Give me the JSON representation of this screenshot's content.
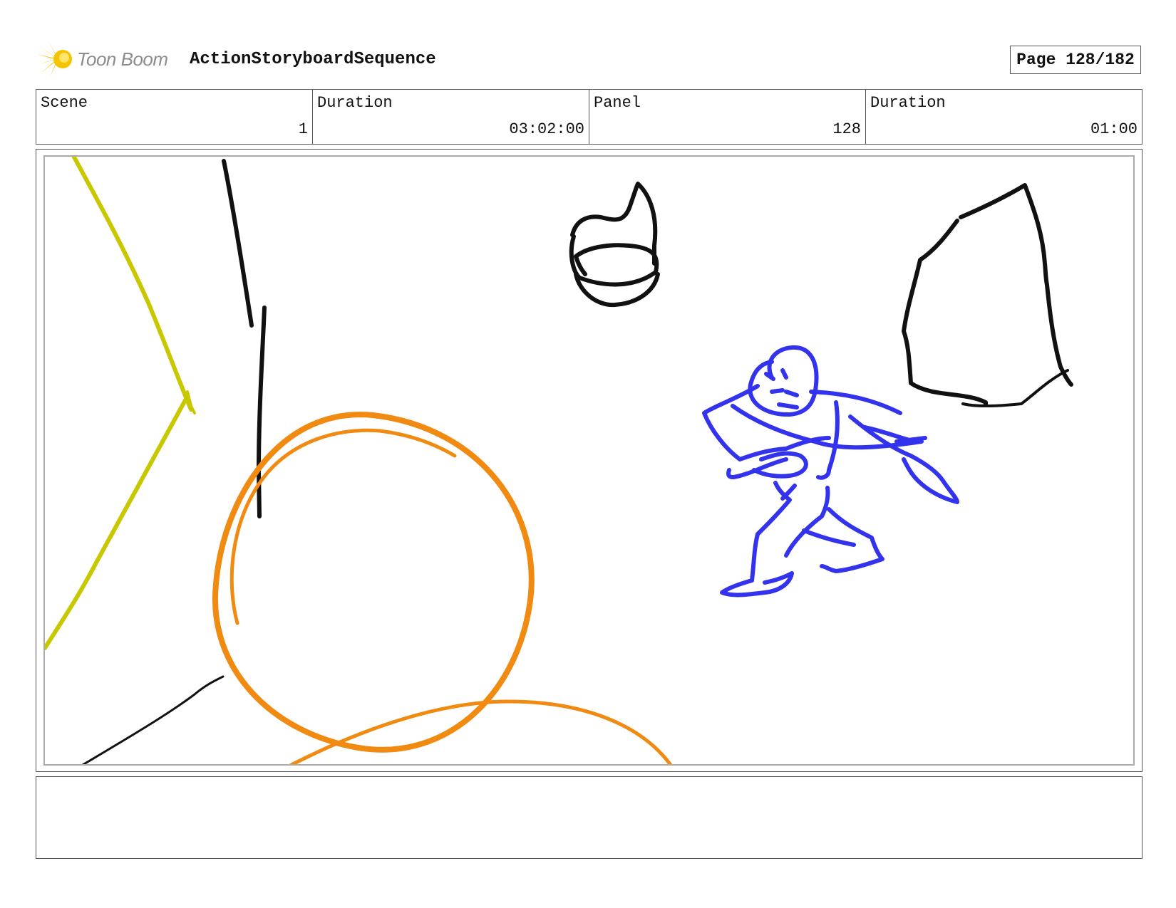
{
  "header": {
    "logo_text": "Toon Boom",
    "sequence_title": "ActionStoryboardSequence",
    "page_label": "Page 128/182"
  },
  "info": [
    {
      "label": "Scene",
      "value": "1"
    },
    {
      "label": "Duration",
      "value": "03:02:00"
    },
    {
      "label": "Panel",
      "value": "128"
    },
    {
      "label": "Duration",
      "value": "01:00"
    }
  ],
  "sketch_colors": {
    "yellow": "#c8c800",
    "black": "#111111",
    "orange": "#f08a10",
    "blue": "#3333ee"
  },
  "notes": {
    "text": ""
  }
}
